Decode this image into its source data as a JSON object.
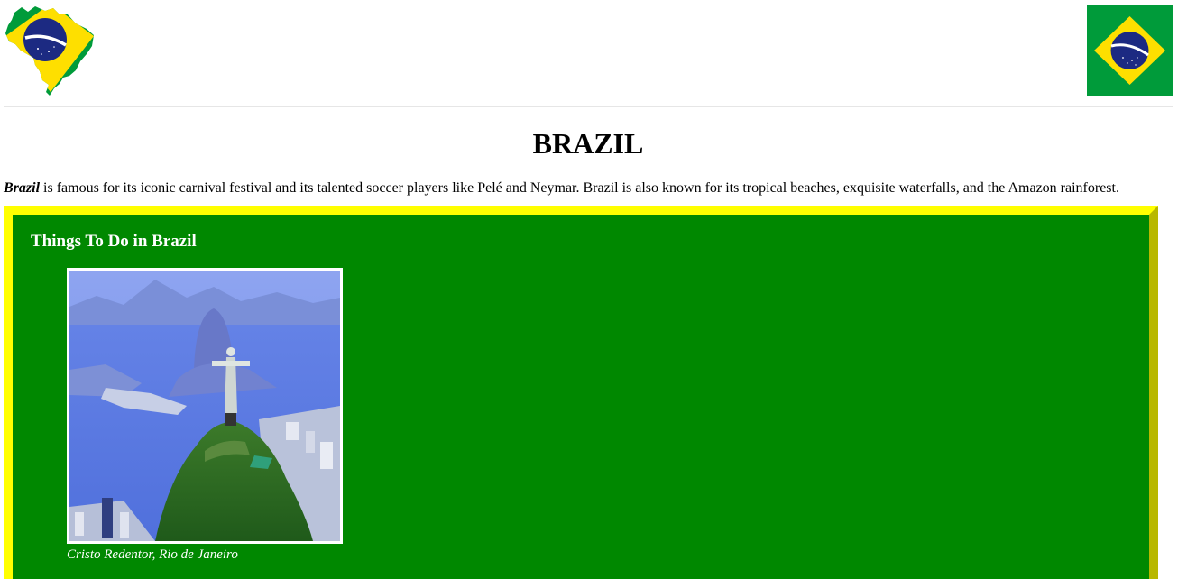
{
  "header": {
    "map_icon": "brazil-map-flag-icon",
    "flag_icon": "brazil-flag-icon",
    "colors": {
      "green": "#009b3a",
      "yellow": "#fedf00",
      "blue": "#002776"
    }
  },
  "title": "BRAZIL",
  "intro": {
    "lead": "Brazil",
    "text": " is famous for its iconic carnival festival and its talented soccer players like Pelé and Neymar. Brazil is also known for its tropical beaches, exquisite waterfalls, and the Amazon rainforest."
  },
  "activities": {
    "title": "Things To Do in Brazil",
    "background_color": "#008800",
    "border_color": "#ffff00",
    "items": [
      {
        "image": "christ-the-redeemer-photo",
        "caption": "Cristo Redentor, Rio de Janeiro"
      }
    ]
  }
}
